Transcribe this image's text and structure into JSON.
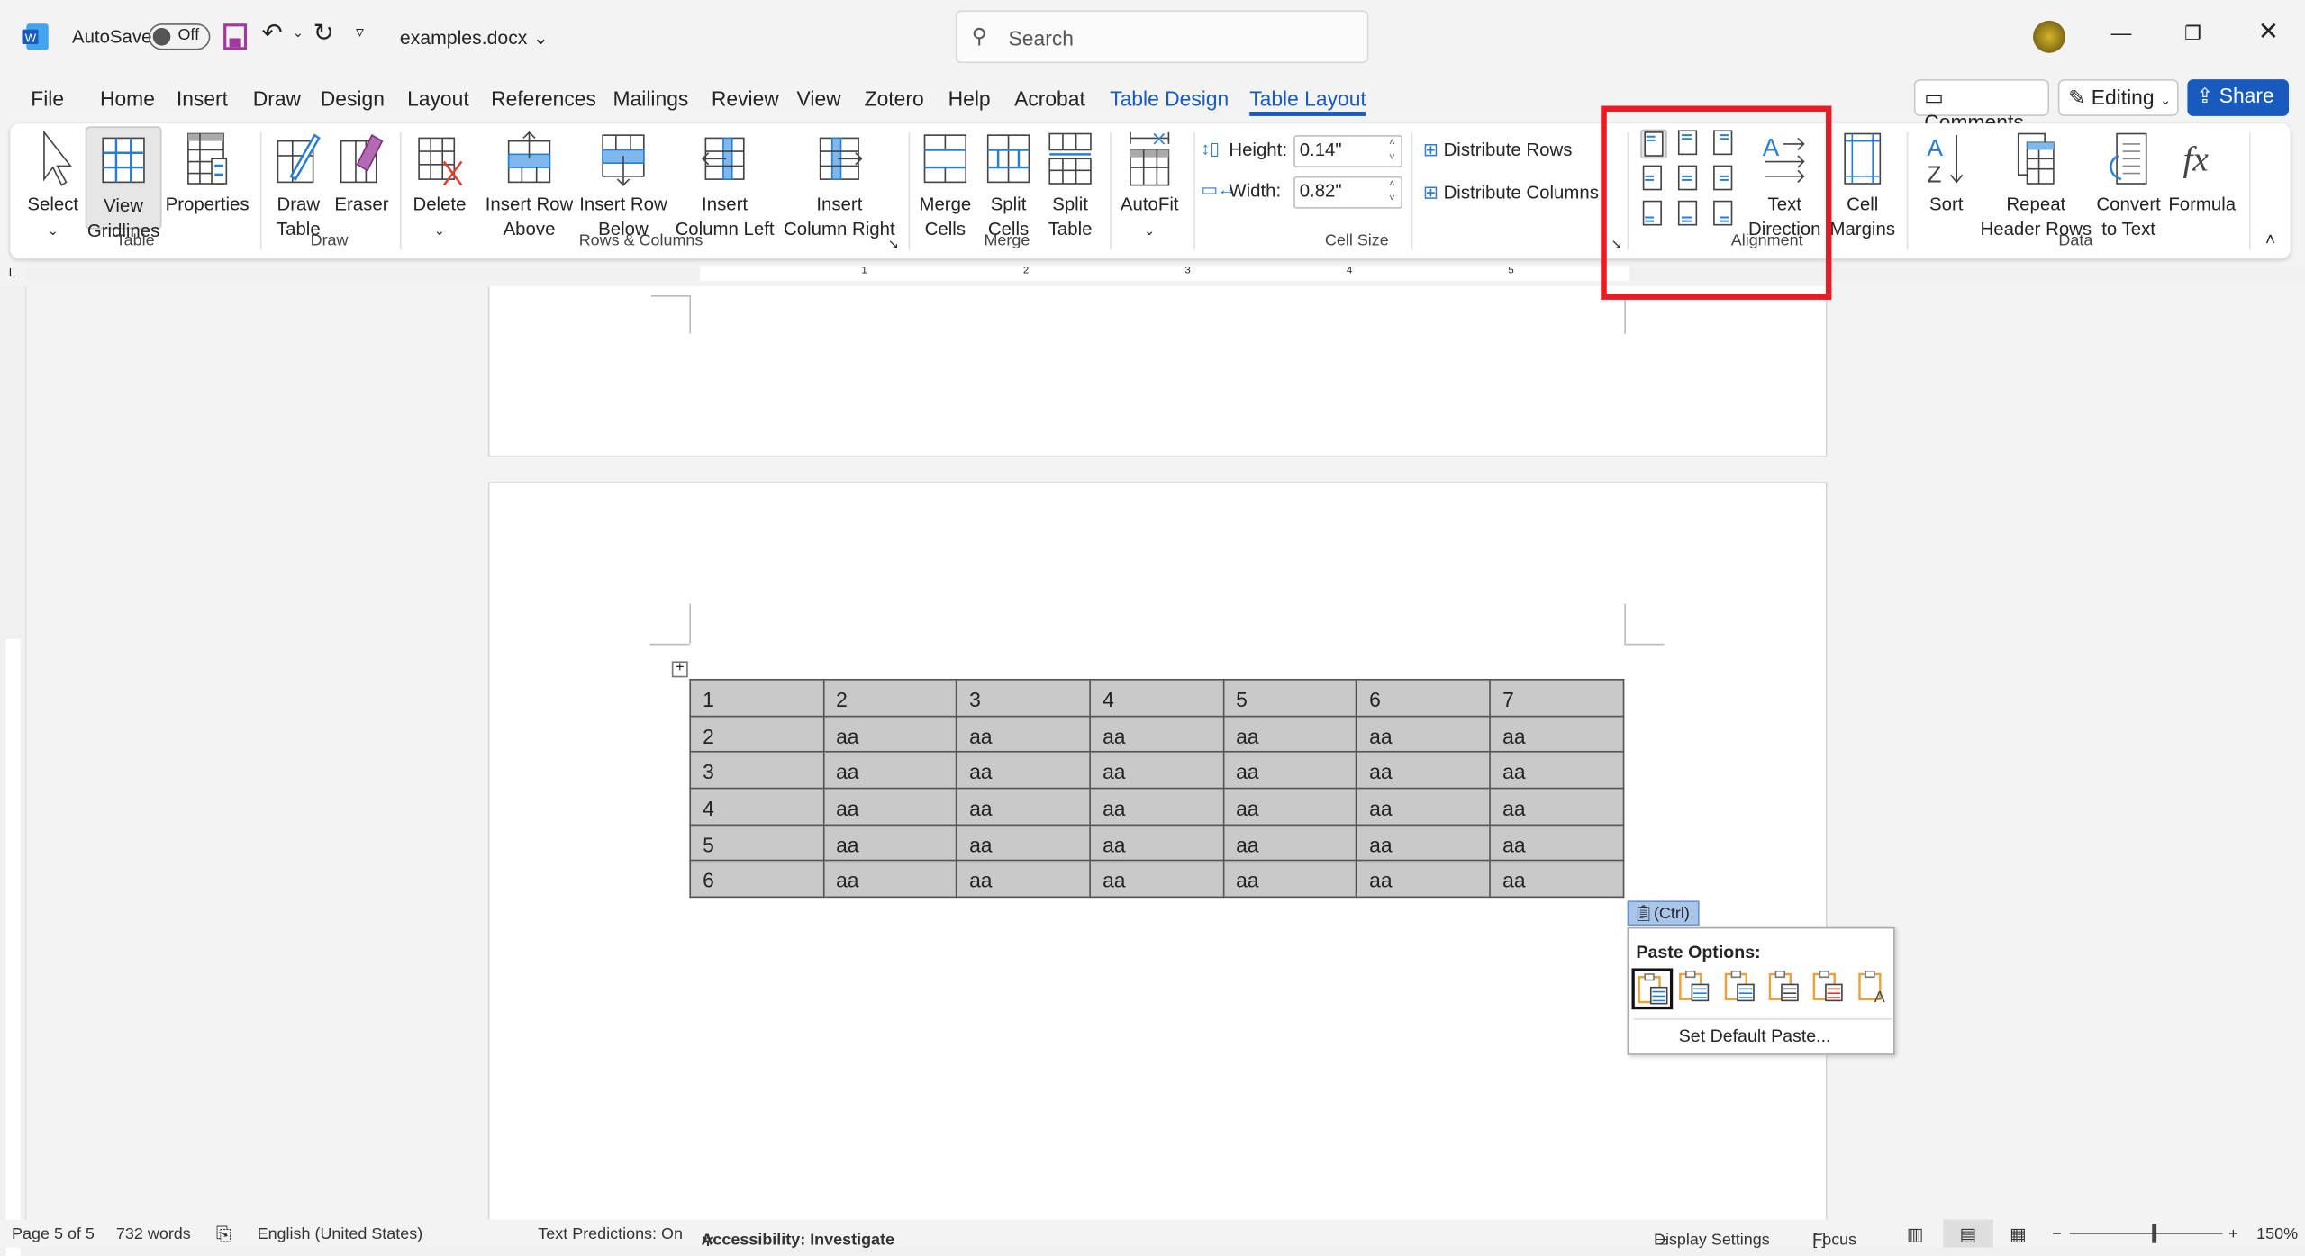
{
  "titlebar": {
    "app_icon": "word-icon",
    "autosave_label": "AutoSave",
    "autosave_state": "Off",
    "filename": "examples.docx",
    "search_placeholder": "Search",
    "window_controls": [
      "minimize",
      "restore",
      "close"
    ]
  },
  "menu_tabs": [
    {
      "label": "File"
    },
    {
      "label": "Home"
    },
    {
      "label": "Insert"
    },
    {
      "label": "Draw"
    },
    {
      "label": "Design"
    },
    {
      "label": "Layout"
    },
    {
      "label": "References"
    },
    {
      "label": "Mailings"
    },
    {
      "label": "Review"
    },
    {
      "label": "View"
    },
    {
      "label": "Zotero"
    },
    {
      "label": "Help"
    },
    {
      "label": "Acrobat"
    },
    {
      "label": "Table Design"
    },
    {
      "label": "Table Layout",
      "active": true
    }
  ],
  "top_right": {
    "comments": "Comments",
    "editing": "Editing",
    "share": "Share"
  },
  "ribbon": {
    "buttons": {
      "select": "Select",
      "view1": "View",
      "view2": "Gridlines",
      "properties": "Properties",
      "draw1": "Draw",
      "draw2": "Table",
      "eraser": "Eraser",
      "delete": "Delete",
      "ira1": "Insert Row",
      "ira2": "Above",
      "irb1": "Insert Row",
      "irb2": "Below",
      "icl1": "Insert",
      "icl2": "Column Left",
      "icr1": "Insert",
      "icr2": "Column Right",
      "merge1": "Merge",
      "merge2": "Cells",
      "split1": "Split",
      "split2": "Cells",
      "splitt1": "Split",
      "splitt2": "Table",
      "autofit": "AutoFit",
      "td1": "Text",
      "td2": "Direction",
      "cm1": "Cell",
      "cm2": "Margins",
      "sort": "Sort",
      "rep1": "Repeat",
      "rep2": "Header Rows",
      "conv1": "Convert",
      "conv2": "to Text",
      "formula": "Formula"
    },
    "cell_size": {
      "height_label": "Height:",
      "height_value": "0.14\"",
      "width_label": "Width:",
      "width_value": "0.82\"",
      "distribute_rows": "Distribute Rows",
      "distribute_columns": "Distribute Columns"
    },
    "groups": {
      "table": "Table",
      "draw": "Draw",
      "rows_columns": "Rows & Columns",
      "merge": "Merge",
      "cell_size": "Cell Size",
      "alignment": "Alignment",
      "data": "Data"
    },
    "highlight_color": "#e81c24"
  },
  "ruler_numbers": [
    "1",
    "2",
    "3",
    "4",
    "5"
  ],
  "table": {
    "rows": [
      [
        "1",
        "2",
        "3",
        "4",
        "5",
        "6",
        "7"
      ],
      [
        "2",
        "aa",
        "aa",
        "aa",
        "aa",
        "aa",
        "aa"
      ],
      [
        "3",
        "aa",
        "aa",
        "aa",
        "aa",
        "aa",
        "aa"
      ],
      [
        "4",
        "aa",
        "aa",
        "aa",
        "aa",
        "aa",
        "aa"
      ],
      [
        "5",
        "aa",
        "aa",
        "aa",
        "aa",
        "aa",
        "aa"
      ],
      [
        "6",
        "aa",
        "aa",
        "aa",
        "aa",
        "aa",
        "aa"
      ]
    ]
  },
  "paste": {
    "ctrl_label": "(Ctrl)",
    "title": "Paste Options:",
    "options": [
      "Use Destination Styles",
      "Keep Source Formatting",
      "Nest Table",
      "Merge Table",
      "Insert as New Rows",
      "Keep Text Only"
    ],
    "set_default": "Set Default Paste..."
  },
  "status": {
    "page": "Page 5 of 5",
    "words": "732 words",
    "language": "English (United States)",
    "predictions": "Text Predictions: On",
    "accessibility": "Accessibility: Investigate",
    "display_settings": "Display Settings",
    "focus": "Focus",
    "zoom": "150%",
    "zoom_level_percent": 150
  }
}
